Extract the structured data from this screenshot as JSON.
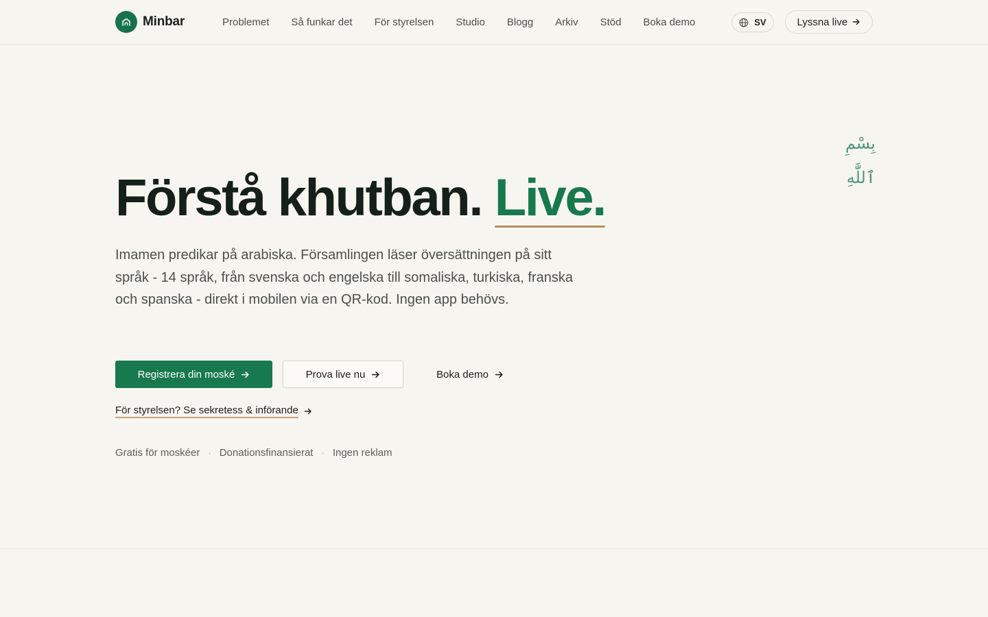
{
  "brand": {
    "name": "Minbar",
    "color": "#16734a",
    "logo_icon": "mosque-home-icon"
  },
  "nav": {
    "items": [
      {
        "label": "Problemet"
      },
      {
        "label": "Så funkar det"
      },
      {
        "label": "För styrelsen"
      },
      {
        "label": "Studio"
      },
      {
        "label": "Blogg"
      },
      {
        "label": "Arkiv"
      },
      {
        "label": "Stöd"
      },
      {
        "label": "Boka demo"
      }
    ],
    "language": {
      "code": "SV",
      "icon": "globe-icon"
    },
    "listen_button": {
      "label": "Lyssna live",
      "icon": "arrow-right-icon"
    }
  },
  "hero": {
    "ornament": "بِسْمِ ٱللَّٰهِ",
    "headline_main": "Förstå khutban.",
    "headline_accent": "Live.",
    "lead": "Imamen predikar på arabiska. Församlingen läser översättningen på sitt språk - 14 språk, från svenska och engelska till somaliska, turkiska, franska och spanska - direkt i mobilen via en QR-kod. Ingen app behövs.",
    "primary_cta": "Registrera din moské",
    "secondary_cta": "Prova live nu",
    "tertiary_cta": "Boka demo",
    "board_link": "För styrelsen? Se sekretess & införande",
    "badges": [
      "Gratis för moskéer",
      "Donationsfinansierat",
      "Ingen reklam"
    ],
    "badge_separator": "·"
  },
  "colors": {
    "background": "#f7f5f0",
    "accent_green": "#17794d",
    "underline_gold": "#b58e5c",
    "text_dark": "#16201b",
    "text_muted": "#4b504c"
  }
}
